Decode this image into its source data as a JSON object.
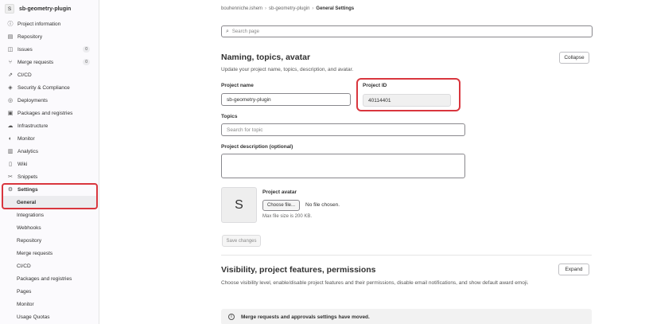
{
  "sidebar": {
    "project_initial": "S",
    "project_name": "sb-geometry-plugin",
    "items": [
      {
        "label": "Project information",
        "icon": "info-icon"
      },
      {
        "label": "Repository",
        "icon": "doc-icon"
      },
      {
        "label": "Issues",
        "icon": "issues-icon",
        "badge": "0"
      },
      {
        "label": "Merge requests",
        "icon": "merge-request-icon",
        "badge": "0"
      },
      {
        "label": "CI/CD",
        "icon": "rocket-icon"
      },
      {
        "label": "Security & Compliance",
        "icon": "shield-icon"
      },
      {
        "label": "Deployments",
        "icon": "deployments-icon"
      },
      {
        "label": "Packages and registries",
        "icon": "package-icon"
      },
      {
        "label": "Infrastructure",
        "icon": "cloud-icon"
      },
      {
        "label": "Monitor",
        "icon": "monitor-icon"
      },
      {
        "label": "Analytics",
        "icon": "chart-icon"
      },
      {
        "label": "Wiki",
        "icon": "book-icon"
      },
      {
        "label": "Snippets",
        "icon": "scissors-icon"
      },
      {
        "label": "Settings",
        "icon": "gear-icon"
      }
    ],
    "settings_subitems": [
      "General",
      "Integrations",
      "Webhooks",
      "Repository",
      "Merge requests",
      "CI/CD",
      "Packages and registries",
      "Pages",
      "Monitor",
      "Usage Quotas"
    ]
  },
  "breadcrumb": {
    "owner": "bouhenniche.ishem",
    "project": "sb-geometry-plugin",
    "current": "General Settings"
  },
  "search": {
    "placeholder": "Search page"
  },
  "naming": {
    "title": "Naming, topics, avatar",
    "collapse_label": "Collapse",
    "description": "Update your project name, topics, description, and avatar.",
    "project_name_label": "Project name",
    "project_name_value": "sb-geometry-plugin",
    "project_id_label": "Project ID",
    "project_id_value": "40114401",
    "topics_label": "Topics",
    "topics_placeholder": "Search for topic",
    "description_label": "Project description (optional)",
    "avatar_initial": "S",
    "avatar_label": "Project avatar",
    "choose_file_label": "Choose file...",
    "no_file_label": "No file chosen.",
    "max_size_label": "Max file size is 200 KB.",
    "save_label": "Save changes"
  },
  "visibility": {
    "title": "Visibility, project features, permissions",
    "expand_label": "Expand",
    "description": "Choose visibility level, enable/disable project features and their permissions, disable email notifications, and show default award emoji."
  },
  "alert": {
    "text": "Merge requests and approvals settings have moved."
  },
  "colors": {
    "highlight": "#d9363e",
    "active_bg": "#ececef"
  }
}
